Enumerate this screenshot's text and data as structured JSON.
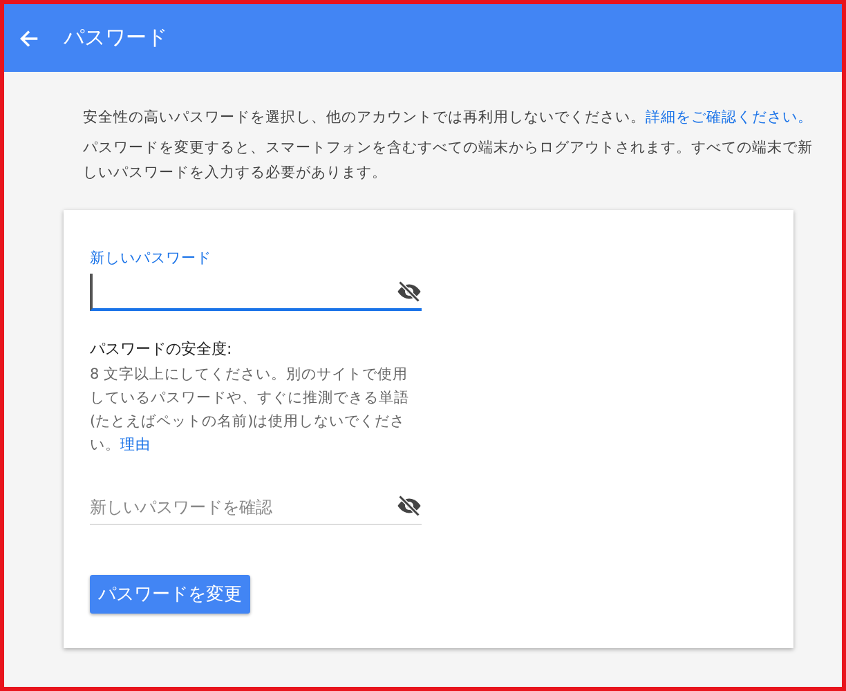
{
  "app_bar": {
    "title": "パスワード"
  },
  "intro": [
    {
      "text": "安全性の高いパスワードを選択し、他のアカウントでは再利用しないでください。",
      "link": "詳細をご確認ください。"
    },
    {
      "text": "パスワードを変更すると、スマートフォンを含むすべての端末からログアウトされます。すべての端末で新しいパスワードを入力する必要があります。"
    }
  ],
  "new_password": {
    "label": "新しいパスワード",
    "focused": true
  },
  "strength": {
    "heading": "パスワードの安全度:",
    "text": "8 文字以上にしてください。別のサイトで使用しているパスワードや、すぐに推測できる単語(たとえばペットの名前)は使用しないでください。",
    "link": "理由"
  },
  "confirm_password": {
    "placeholder": "新しいパスワードを確認",
    "focused": false
  },
  "submit_button": "パスワードを変更"
}
